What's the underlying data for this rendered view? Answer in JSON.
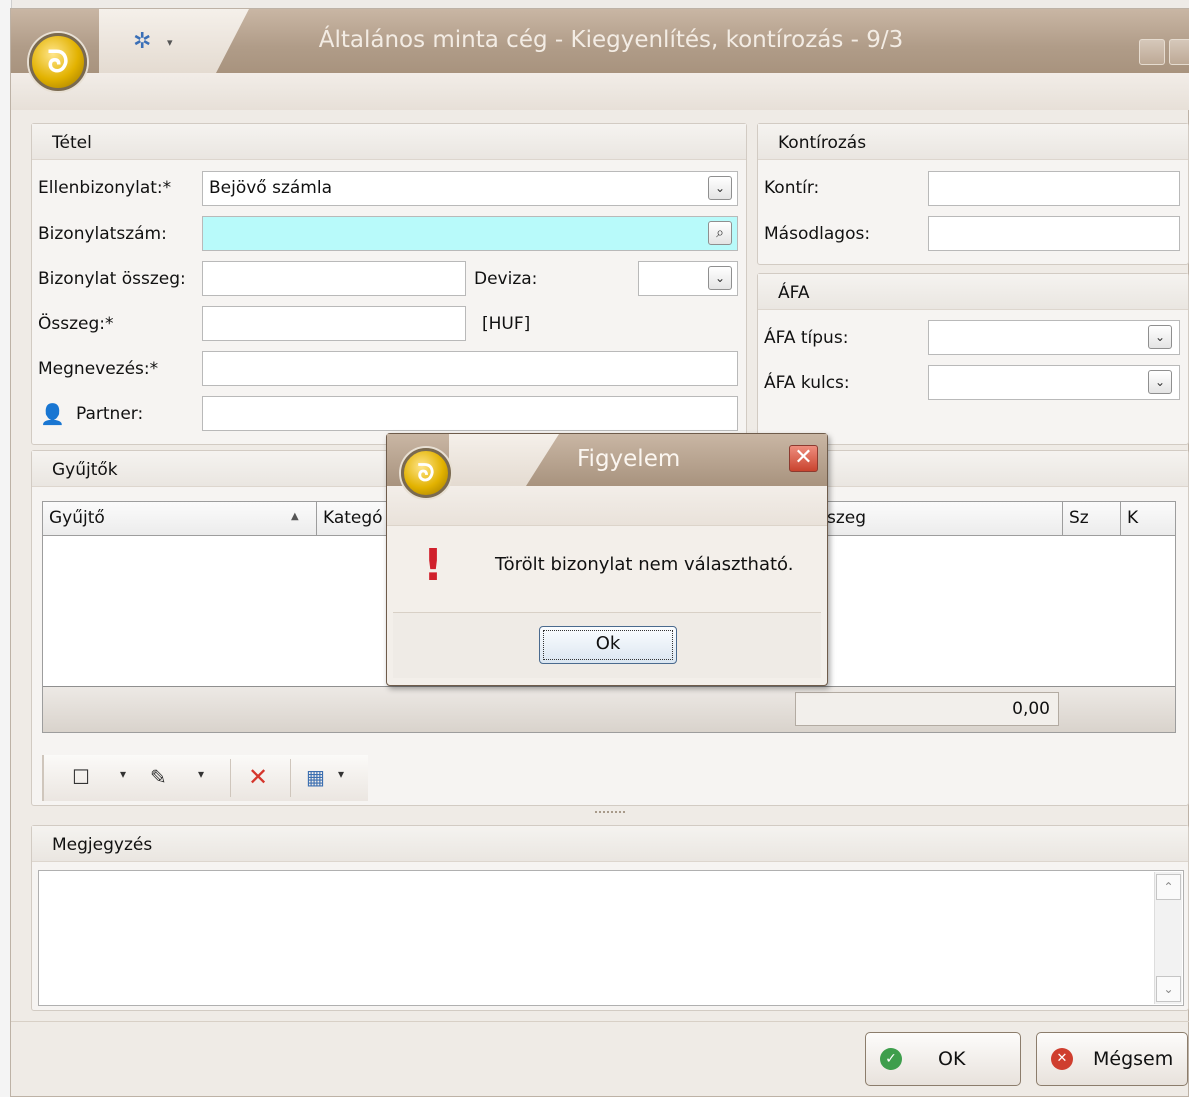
{
  "window": {
    "title": "Általános minta cég - Kiegyenlítés, kontírozás - 9/3"
  },
  "tetel": {
    "header": "Tétel",
    "ellenbizonylat_label": "Ellenbizonylat:*",
    "ellenbizonylat_value": "Bejövő számla",
    "bizonylatszam_label": "Bizonylatszám:",
    "bizonylatszam_value": "",
    "bizonylat_osszeg_label": "Bizonylat összeg:",
    "bizonylat_osszeg_value": "",
    "deviza_label": "Deviza:",
    "deviza_value": "",
    "osszeg_label": "Összeg:*",
    "osszeg_value": "",
    "currency_unit": "[HUF]",
    "megnevezes_label": "Megnevezés:*",
    "megnevezes_value": "",
    "partner_label": "Partner:",
    "partner_value": ""
  },
  "kontirozas": {
    "header": "Kontírozás",
    "kontir_label": "Kontír:",
    "kontir_value": "",
    "masodlagos_label": "Másodlagos:",
    "masodlagos_value": ""
  },
  "afa": {
    "header": "ÁFA",
    "tipus_label": "ÁFA típus:",
    "tipus_value": "",
    "kulcs_label": "ÁFA kulcs:",
    "kulcs_value": ""
  },
  "gyujtok": {
    "header": "Gyűjtők",
    "columns": [
      "Gyűjtő",
      "Kategó",
      "szeg",
      "Sz",
      "K"
    ],
    "sort_indicator": "▲",
    "total": "0,00"
  },
  "megjegyzes": {
    "header": "Megjegyzés",
    "value": ""
  },
  "footer": {
    "ok_label": "OK",
    "cancel_label": "Mégsem"
  },
  "dialog": {
    "title": "Figyelem",
    "message": "Törölt bizonylat nem választható.",
    "ok_label": "Ok",
    "icon": "exclamation-icon"
  },
  "colors": {
    "highlight_field": "#b8fafa",
    "titlebar": "#b09c88",
    "error_red": "#d0202c"
  }
}
